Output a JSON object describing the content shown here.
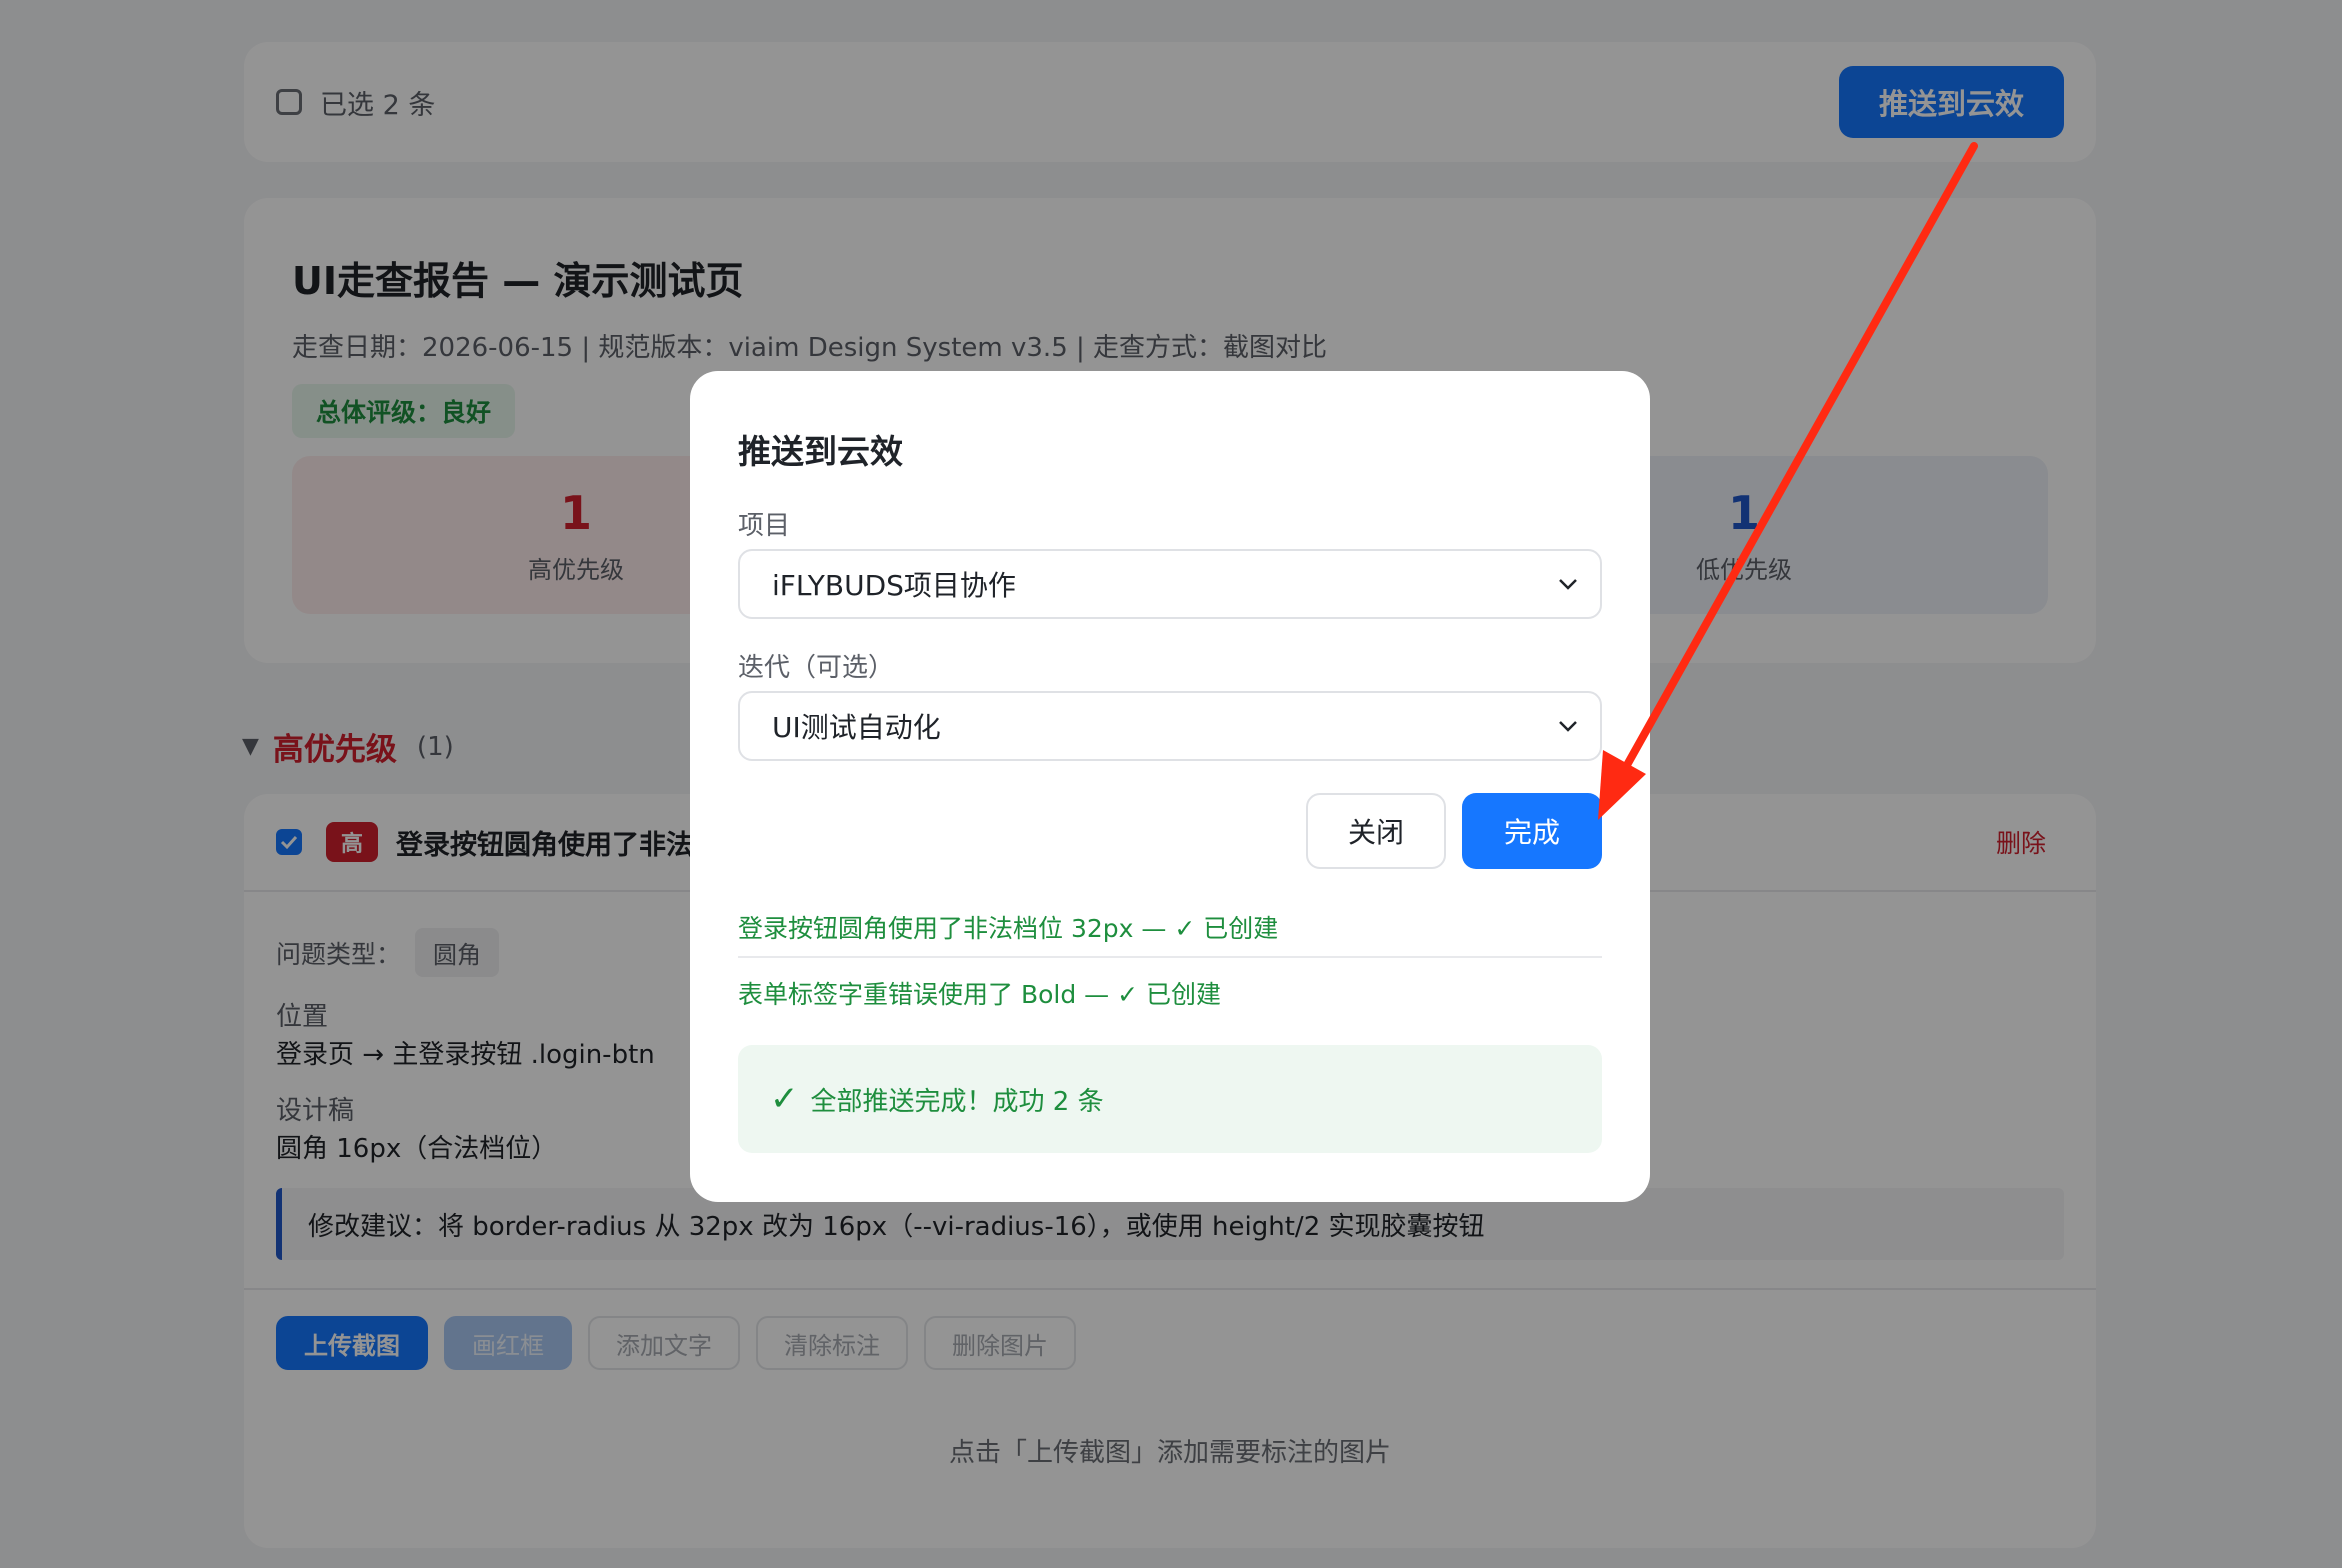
{
  "topbar": {
    "selected_text": "已选 2 条",
    "push_button": "推送到云效"
  },
  "report": {
    "title": "UI走查报告 — 演示测试页",
    "meta": "走查日期：2026-06-15  |  规范版本：viaim Design System v3.5  |  走查方式：截图对比",
    "grade": "总体评级：良好",
    "stats": {
      "high": {
        "count": "1",
        "label": "高优先级"
      },
      "low": {
        "count": "1",
        "label": "低优先级"
      }
    }
  },
  "section": {
    "caret": "▼",
    "title": "高优先级",
    "count": "(1)"
  },
  "issue": {
    "badge": "高",
    "title": "登录按钮圆角使用了非法",
    "delete_label": "删除",
    "type_label": "问题类型：",
    "type_tag": "圆角",
    "position_label": "位置",
    "position_value": "登录页 → 主登录按钮 .login-btn",
    "design_label": "设计稿",
    "design_value": "圆角 16px（合法档位）",
    "suggestion": "修改建议：将 border-radius 从 32px 改为 16px（--vi-radius-16），或使用 height/2 实现胶囊按钮",
    "tools": [
      "上传截图",
      "画红框",
      "添加文字",
      "清除标注",
      "删除图片"
    ],
    "upload_hint": "点击「上传截图」添加需要标注的图片"
  },
  "modal": {
    "title": "推送到云效",
    "project_label": "项目",
    "project_value": "iFLYBUDS项目协作",
    "iteration_label": "迭代（可选）",
    "iteration_value": "UI测试自动化",
    "close_label": "关闭",
    "done_label": "完成",
    "results": [
      "登录按钮圆角使用了非法档位 32px — ✓ 已创建",
      "表单标签字重错误使用了 Bold — ✓ 已创建"
    ],
    "success_check": "✓",
    "success_text": "全部推送完成！成功 2 条"
  },
  "colors": {
    "primary": "#1677ff",
    "danger": "#d0202e",
    "success": "#1e8e3e",
    "annotation_arrow": "#ff2a12"
  }
}
